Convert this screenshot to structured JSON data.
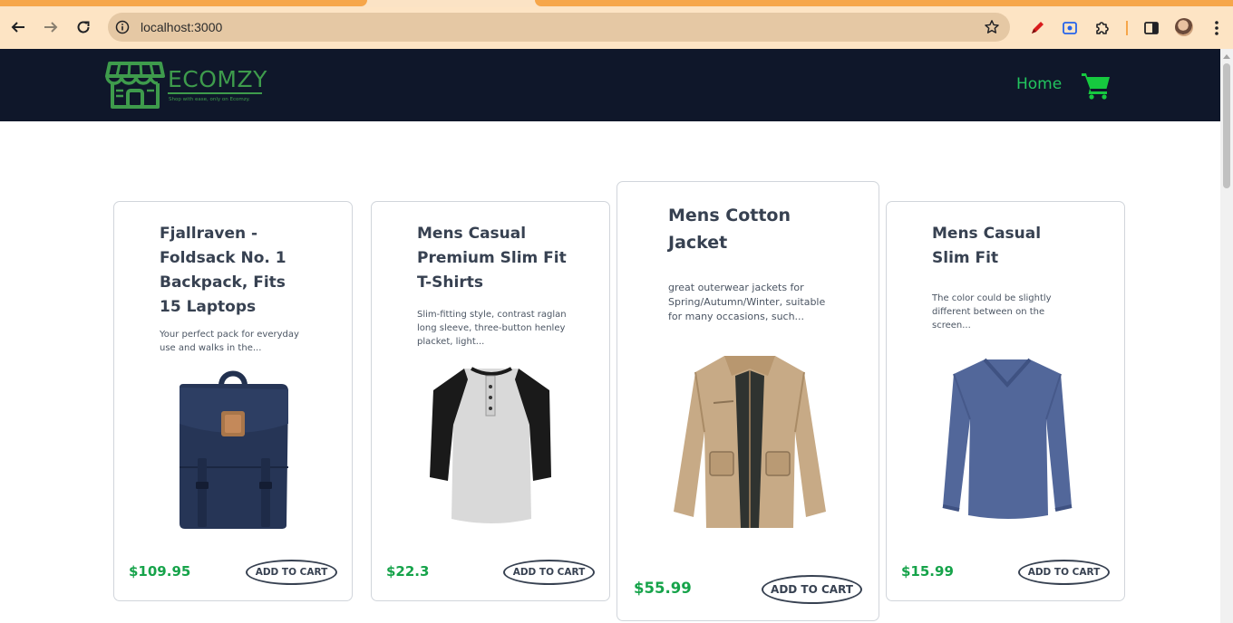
{
  "browser": {
    "url": "localhost:3000",
    "icons": [
      "back-arrow-icon",
      "forward-arrow-icon",
      "reload-icon",
      "info-icon",
      "star-icon",
      "pen-extension-icon",
      "screen-capture-extension-icon",
      "puzzle-extensions-icon",
      "side-panel-icon",
      "profile-avatar",
      "more-vertical-icon"
    ]
  },
  "header": {
    "logo_name": "ECOMZY",
    "logo_tagline": "Shop with ease, only on Ecomzy.",
    "nav_home": "Home",
    "cart_icon": "shopping-cart-icon",
    "colors": {
      "background": "#0f172a",
      "accent": "#22c55e",
      "logo": "#3e9b4c"
    }
  },
  "products": [
    {
      "title": "Fjallraven - Foldsack No. 1 Backpack, Fits 15 Laptops",
      "description": "Your perfect pack for everyday use and walks in the...",
      "price": "$109.95",
      "button": "ADD TO CART",
      "image": "navy backpack"
    },
    {
      "title": "Mens Casual Premium Slim Fit T-Shirts",
      "description": "Slim-fitting style, contrast raglan long sleeve, three-button henley placket, light...",
      "price": "$22.3",
      "button": "ADD TO CART",
      "image": "grey and black raglan henley shirt"
    },
    {
      "title": "Mens Cotton Jacket",
      "description": "great outerwear jackets for Spring/Autumn/Winter, suitable for many occasions, such...",
      "price": "$55.99",
      "button": "ADD TO CART",
      "image": "khaki cotton jacket"
    },
    {
      "title": "Mens Casual Slim Fit",
      "description": "The color could be slightly different between on the screen...",
      "price": "$15.99",
      "button": "ADD TO CART",
      "image": "blue long sleeve v-neck shirt"
    }
  ],
  "colors": {
    "price": "#16a34a",
    "card_border": "#d1d5db",
    "title": "#374151"
  }
}
